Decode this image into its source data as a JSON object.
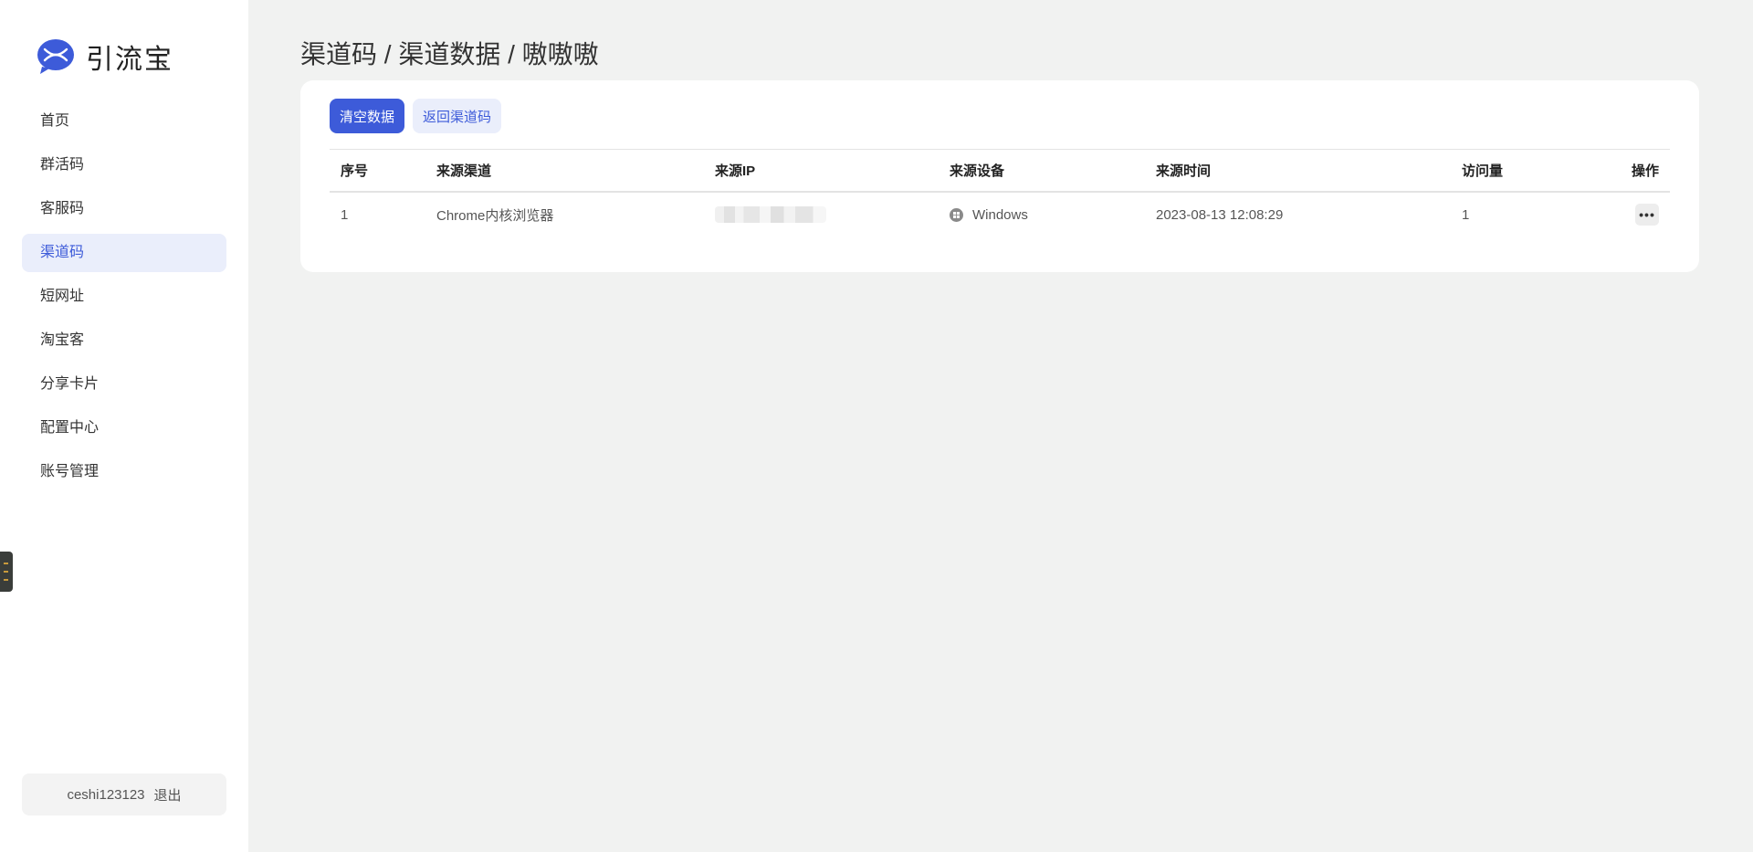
{
  "app": {
    "name": "引流宝",
    "brand_color": "#3d5bd9"
  },
  "sidebar": {
    "items": [
      {
        "label": "首页"
      },
      {
        "label": "群活码"
      },
      {
        "label": "客服码"
      },
      {
        "label": "渠道码",
        "active": true
      },
      {
        "label": "短网址"
      },
      {
        "label": "淘宝客"
      },
      {
        "label": "分享卡片"
      },
      {
        "label": "配置中心"
      },
      {
        "label": "账号管理"
      }
    ],
    "user": {
      "name": "ceshi123123",
      "logout_label": "退出"
    }
  },
  "header": {
    "title": "渠道码 / 渠道数据 / 嗷嗷嗷"
  },
  "toolbar": {
    "clear_label": "清空数据",
    "back_label": "返回渠道码"
  },
  "table": {
    "columns": [
      "序号",
      "来源渠道",
      "来源IP",
      "来源设备",
      "来源时间",
      "访问量",
      "操作"
    ],
    "rows": [
      {
        "index": "1",
        "channel": "Chrome内核浏览器",
        "ip_icon": "blurred-ip",
        "device_icon": "windows-icon",
        "device": "Windows",
        "time": "2023-08-13 12:08:29",
        "visits": "1",
        "action_icon": "more-icon",
        "action": "•••"
      }
    ]
  }
}
